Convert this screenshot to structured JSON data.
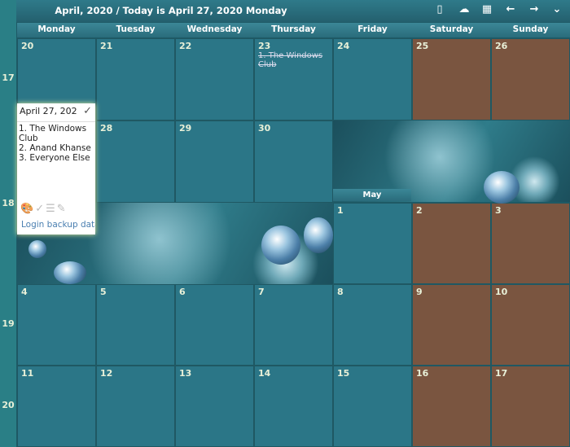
{
  "header": {
    "title": "April, 2020 / Today is April 27, 2020 Monday",
    "icons": [
      "phone-icon",
      "cloud-icon",
      "calendar-icon",
      "arrow-left-icon",
      "arrow-right-icon",
      "chevron-down-icon"
    ]
  },
  "days": [
    "Monday",
    "Tuesday",
    "Wednesday",
    "Thursday",
    "Friday",
    "Saturday",
    "Sunday"
  ],
  "weeks": [
    "17",
    "18",
    "19",
    "20"
  ],
  "cells": {
    "r1": [
      "20",
      "21",
      "22",
      "23",
      "24",
      "25",
      "26"
    ],
    "r2": [
      "28",
      "29",
      "30"
    ],
    "r3": [
      "1",
      "2",
      "3"
    ],
    "r4": [
      "4",
      "5",
      "6",
      "7",
      "8",
      "9",
      "10"
    ],
    "r5": [
      "11",
      "12",
      "13",
      "14",
      "15",
      "16",
      "17"
    ]
  },
  "events": {
    "apr23": "1. The Windows Club"
  },
  "month_label": "May",
  "popup": {
    "date": "April 27, 202",
    "notes": [
      "1. The Windows Club",
      "2. Anand Khanse",
      "3. Everyone Else"
    ],
    "login": "Login backup data"
  },
  "colors": {
    "cell": "#2c788a",
    "weekend": "#7a5540",
    "header": "#2f7a8a"
  }
}
